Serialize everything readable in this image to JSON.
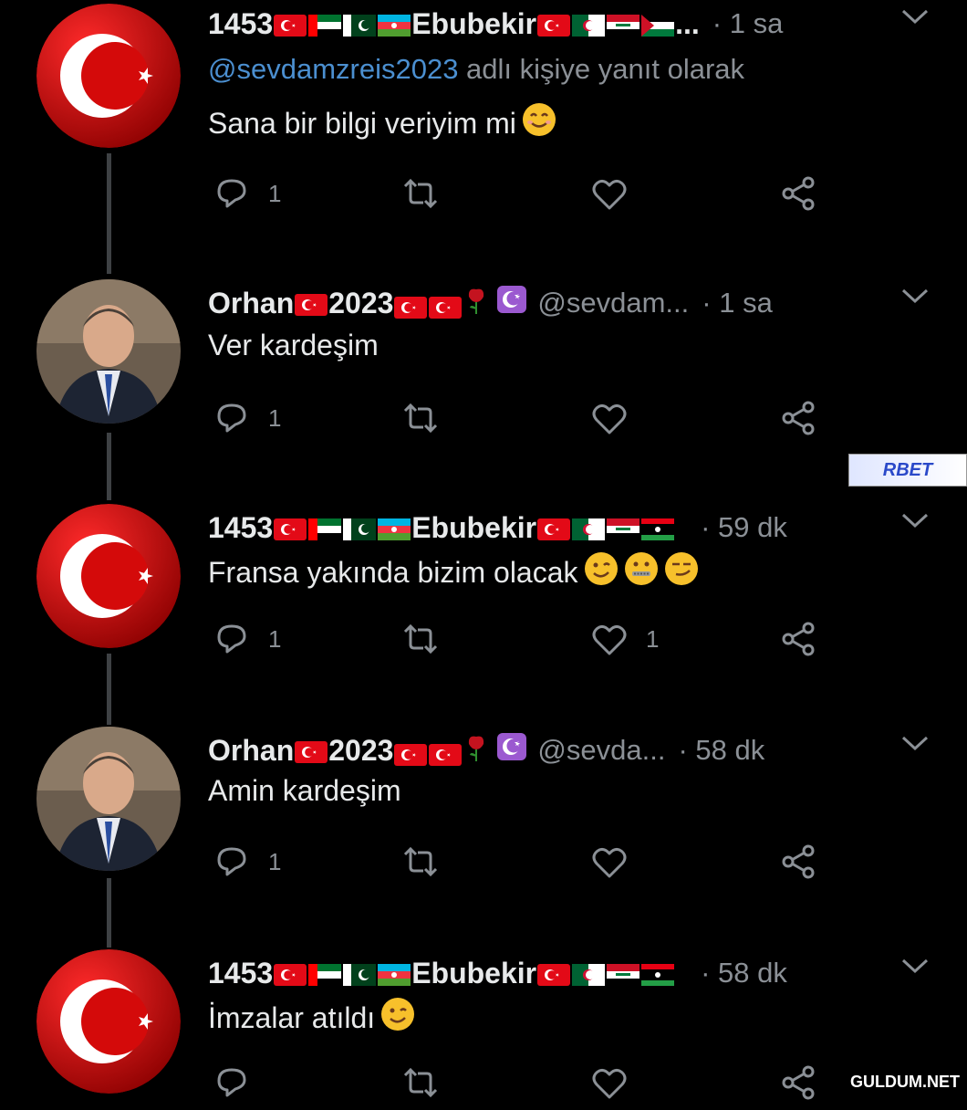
{
  "colors": {
    "bg": "#000000",
    "text": "#e7e9ea",
    "muted": "#8b9096",
    "link": "#4b8fd0",
    "thread_line": "#3e4144"
  },
  "tweets": [
    {
      "name": "1453",
      "name_suffix": "Ebubekir",
      "handle": "",
      "time": "· 1 sa",
      "reply_to": {
        "mention": "@sevdamzreis2023",
        "text": " adlı kişiye yanıt olarak"
      },
      "text": "Sana bir bilgi veriyim mi",
      "emojis": [
        "smiling-face-icon"
      ],
      "avatar": "turkish-flag",
      "actions": {
        "reply_count": "1",
        "retweet_count": "",
        "like_count": ""
      }
    },
    {
      "name": "Orhan",
      "name_suffix": "2023",
      "handle": "@sevdam...",
      "time": "· 1 sa",
      "text": "Ver kardeşim",
      "emojis": [],
      "avatar": "person-photo",
      "actions": {
        "reply_count": "1",
        "retweet_count": "",
        "like_count": ""
      }
    },
    {
      "name": "1453",
      "name_suffix": "Ebubekir",
      "handle": "",
      "time": "· 59 dk",
      "text": "Fransa yakında bizim olacak",
      "emojis": [
        "winking-face-icon",
        "zipper-mouth-face-icon",
        "smirking-face-icon"
      ],
      "avatar": "turkish-flag",
      "actions": {
        "reply_count": "1",
        "retweet_count": "",
        "like_count": "1"
      }
    },
    {
      "name": "Orhan",
      "name_suffix": "2023",
      "handle": "@sevda...",
      "time": "· 58 dk",
      "text": "Amin kardeşim",
      "emojis": [],
      "avatar": "person-photo",
      "actions": {
        "reply_count": "1",
        "retweet_count": "",
        "like_count": ""
      }
    },
    {
      "name": "1453",
      "name_suffix": "Ebubekir",
      "handle": "",
      "time": "· 58 dk",
      "text": "İmzalar atıldı",
      "emojis": [
        "winking-face-icon"
      ],
      "avatar": "turkish-flag",
      "actions": {
        "reply_count": "",
        "retweet_count": "",
        "like_count": ""
      }
    }
  ],
  "ad": {
    "label": "RBET"
  },
  "watermark": "GULDUM.NET"
}
